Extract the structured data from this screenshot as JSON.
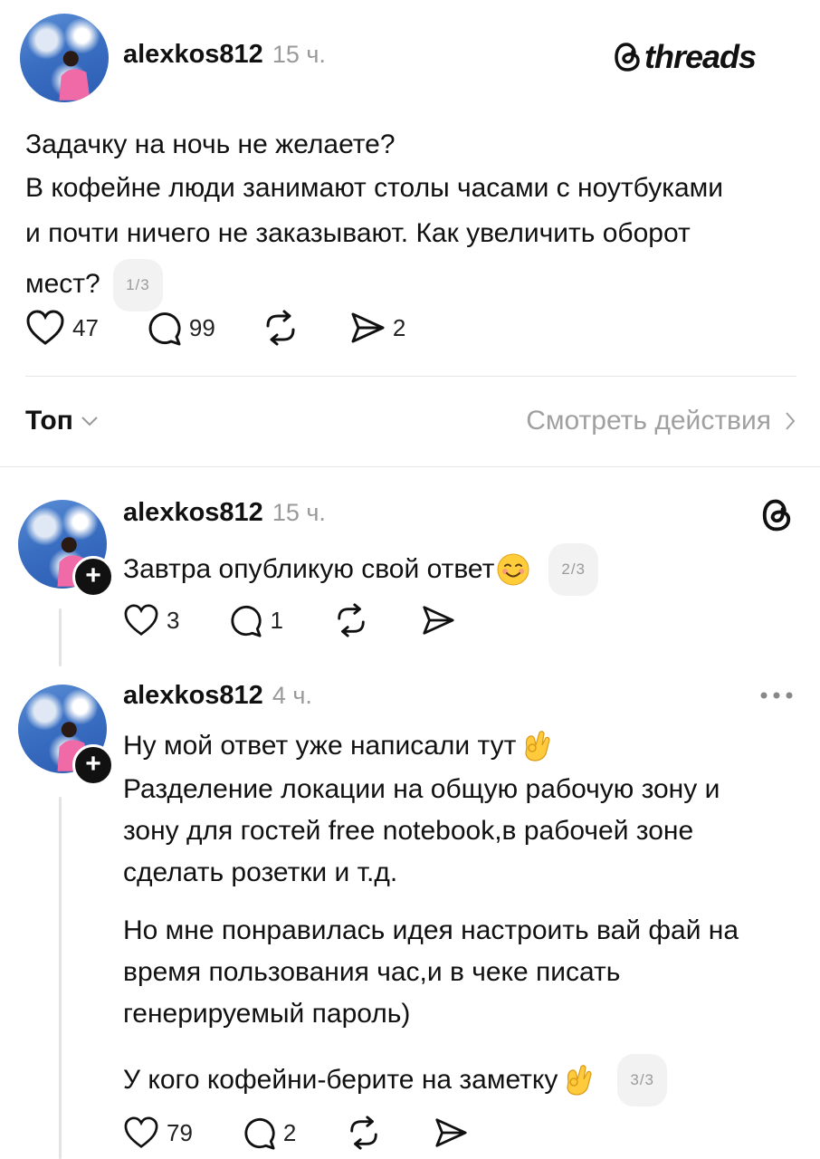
{
  "brand": {
    "logo_text": "threads"
  },
  "post": {
    "username": "alexkos812",
    "time": "15 ч.",
    "lines": [
      "Задачку на ночь не желаете?",
      "В кофейне люди занимают столы часами с ноутбуками",
      "и почти ничего не заказывают. Как увеличить оборот",
      "мест?"
    ],
    "pager": "1/3",
    "likes": "47",
    "comments": "99",
    "shares": "2"
  },
  "filter": {
    "sort_label": "Топ",
    "activity_link": "Смотреть действия"
  },
  "replies": [
    {
      "username": "alexkos812",
      "time": "15 ч.",
      "text": "Завтра опубликую свой ответ",
      "pager": "2/3",
      "likes": "3",
      "comments": "1"
    },
    {
      "username": "alexkos812",
      "time": "4 ч.",
      "paragraphs": [
        [
          "Ну мой ответ уже написали тут",
          "Разделение локации на общую рабочую зону и",
          "зону для гостей free notebook,в рабочей зоне",
          "сделать розетки и т.д."
        ],
        [
          "Но мне понравилась идея настроить вай фай на",
          "время пользования час,и в чеке писать",
          "генерируемый пароль)"
        ],
        [
          "У кого кофейни-берите на заметку"
        ]
      ],
      "pager": "3/3",
      "likes": "79",
      "comments": "2"
    }
  ]
}
